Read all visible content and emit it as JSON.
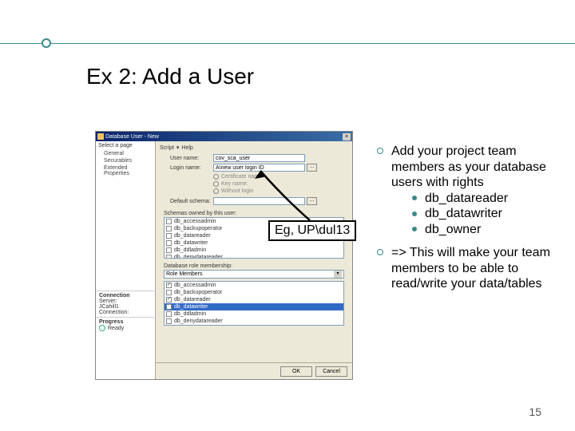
{
  "slide": {
    "title": "Ex 2: Add a User",
    "page_number": "15"
  },
  "annotation": {
    "text": "Eg, UP\\dul13"
  },
  "bullets": {
    "b1": "Add your project team members as your database users with rights",
    "subs": [
      "db_datareader",
      "db_datawriter",
      "db_owner"
    ],
    "b2": "=> This will make your team members to be able to read/write your data/tables"
  },
  "dialog": {
    "title": "Database User - New",
    "toolbar": {
      "script": "Script",
      "help": "Help"
    },
    "left_header": "Select a page",
    "left_items": [
      "General",
      "Securables",
      "Extended Properties"
    ],
    "form": {
      "username_label": "User name:",
      "username_value": "cov_sca_user",
      "login_label": "Login name:",
      "login_value": "A\\new user login ID",
      "cert_label": "Certificate name:",
      "key_label": "Key name:",
      "no_login_label": "Without login",
      "schema_label": "Default schema:"
    },
    "schemas_label": "Schemas owned by this user:",
    "schemas": [
      "db_accessadmin",
      "db_backupoperator",
      "db_datareader",
      "db_datawriter",
      "db_ddladmin",
      "db_denydatareader"
    ],
    "roles_label": "Database role membership:",
    "roles_dropdown": "Role Members",
    "roles": [
      "db_accessadmin",
      "db_backupoperator",
      "db_datareader",
      "db_datawriter",
      "db_ddladmin",
      "db_denydatareader"
    ],
    "conn": {
      "label": "Connection",
      "server": "Server:",
      "server_val": "JCahill1",
      "conn_label": "Connection:"
    },
    "progress": {
      "label": "Progress",
      "ready": "Ready"
    },
    "buttons": {
      "ok": "OK",
      "cancel": "Cancel"
    }
  }
}
